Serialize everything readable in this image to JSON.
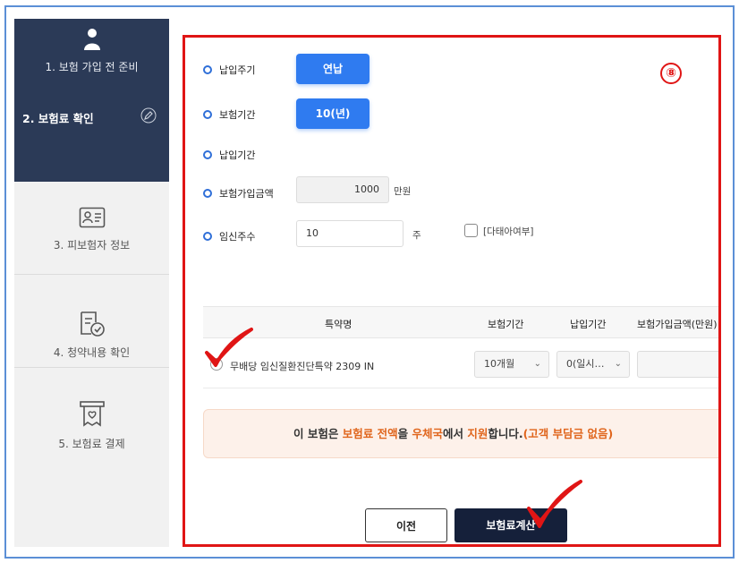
{
  "sidebar": {
    "steps": [
      {
        "label": "1. 보험 가입 전 준비",
        "icon": "person-icon"
      },
      {
        "label": "2. 보험료 확인",
        "icon": "edit-icon"
      },
      {
        "label": "3. 피보험자 정보",
        "icon": "id-card-icon"
      },
      {
        "label": "4. 청약내용 확인",
        "icon": "document-check-icon"
      },
      {
        "label": "5. 보험료 결제",
        "icon": "receipt-heart-icon"
      }
    ]
  },
  "badge": "⑧",
  "form": {
    "payment_cycle": {
      "label": "납입주기",
      "value": "연납"
    },
    "insurance_period": {
      "label": "보험기간",
      "value": "10(년)"
    },
    "payment_period": {
      "label": "납입기간"
    },
    "sum_insured": {
      "label": "보험가입금액",
      "value": "1000",
      "unit": "만원"
    },
    "pregnancy_weeks": {
      "label": "임신주수",
      "value": "10",
      "unit": "주"
    },
    "twins": {
      "label": "[다태아여부]",
      "checked": false
    }
  },
  "rider_table": {
    "headers": [
      "특약명",
      "보험기간",
      "납입기간",
      "보험가입금액(만원)"
    ],
    "rows": [
      {
        "name": "무배당 임신질환진단특약 2309 IN",
        "period": "10개월",
        "payment": "0(일시…",
        "amount": ""
      }
    ]
  },
  "notice": {
    "p1": "이 보험은 ",
    "h1": "보험료 전액",
    "p2": "을 ",
    "h2": "우체국",
    "p3": "에서 ",
    "h3": "지원",
    "p4": "합니다.",
    "h4": "(고객 부담금 없음)"
  },
  "buttons": {
    "prev": "이전",
    "calc": "보험료계산"
  },
  "colors": {
    "sidebar_active": "#2b3a57",
    "accent_blue": "#2f7bf0",
    "annotation_red": "#e01515",
    "highlight_orange": "#e0651c"
  }
}
